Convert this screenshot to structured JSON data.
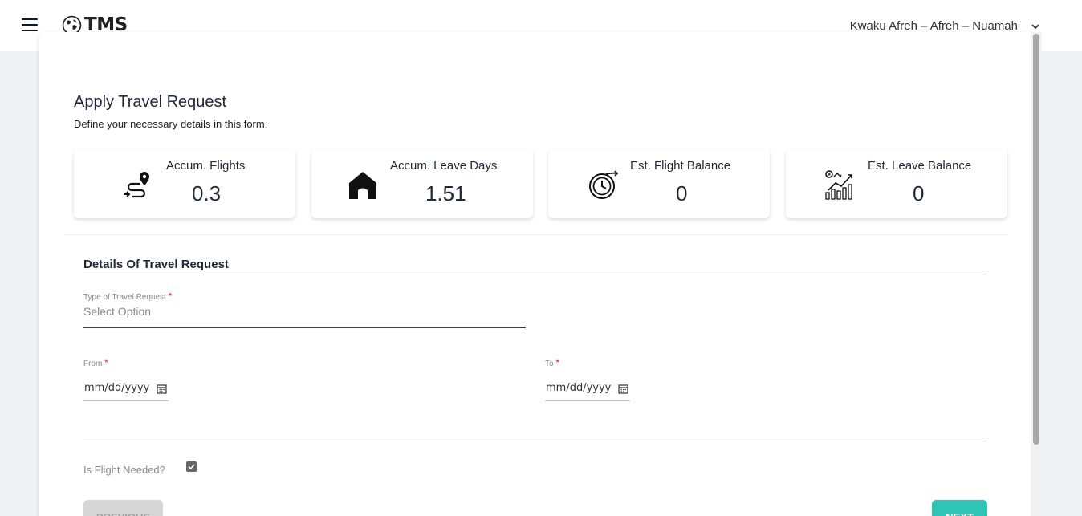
{
  "app": {
    "name": "TMS"
  },
  "header": {
    "user_name": "Kwaku Afreh – Afreh – Nuamah"
  },
  "page": {
    "title": "Apply Travel Request",
    "subtitle": "Define your necessary details in this form."
  },
  "stats": [
    {
      "label": "Accum. Flights",
      "value": "0.3",
      "icon": "flight-route-icon"
    },
    {
      "label": "Accum. Leave Days",
      "value": "1.51",
      "icon": "house-icon"
    },
    {
      "label": "Est. Flight Balance",
      "value": "0",
      "icon": "clock-arrow-icon"
    },
    {
      "label": "Est. Leave Balance",
      "value": "0",
      "icon": "growth-chart-icon"
    }
  ],
  "form": {
    "section_title": "Details Of Travel Request",
    "type_label": "Type of Travel Request",
    "type_placeholder": "Select Option",
    "from_label": "From",
    "from_value": "mm/dd/yyyy",
    "to_label": "To",
    "to_value": "mm/dd/yyyy",
    "required_mark": "*",
    "flight_needed_label": "Is Flight Needed?",
    "flight_needed_checked": true
  },
  "buttons": {
    "previous": "PREVIOUS",
    "next": "NEXT"
  },
  "colors": {
    "accent": "#2ec4b6",
    "required": "#e11d48",
    "disabled": "#d6d6d6"
  }
}
